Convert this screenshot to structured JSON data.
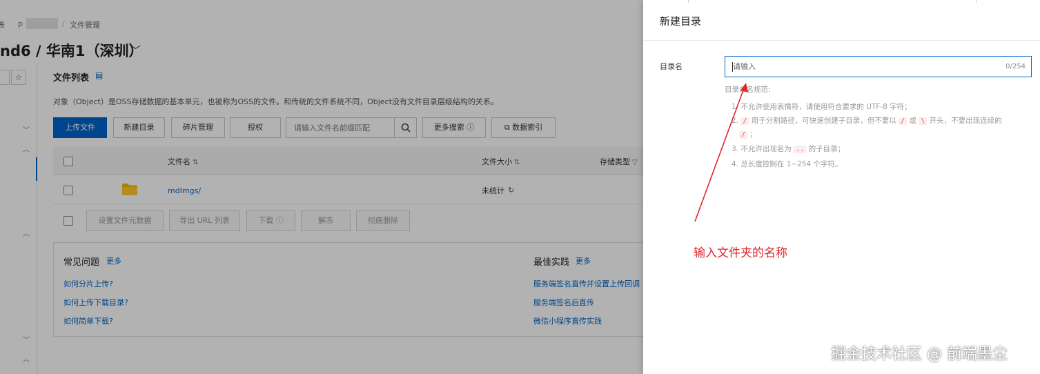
{
  "breadcrumb": {
    "part1": "表",
    "part2": "p",
    "separator": "/",
    "part3": "文件管理"
  },
  "bucket": {
    "title": "nd6 / 华南1（深圳）"
  },
  "file_list": {
    "title": "文件列表",
    "description": "对象（Object）是OSS存储数据的基本单元，也被称为OSS的文件。和传统的文件系统不同，Object没有文件目录层级结构的关系。",
    "toolbar": {
      "upload": "上传文件",
      "new_dir": "新建目录",
      "fragments": "碎片管理",
      "authorize": "授权",
      "search_placeholder": "请输入文件名前缀匹配",
      "more_search": "更多搜索 ⓘ",
      "data_index": "数据索引"
    },
    "columns": {
      "name": "文件名",
      "size": "文件大小",
      "storage": "存储类型"
    },
    "rows": [
      {
        "name": "mdImgs/",
        "size": "未统计"
      }
    ],
    "batch": {
      "set_meta": "设置文件元数据",
      "export_url": "导出 URL 列表",
      "download": "下载 ⓘ",
      "unfreeze": "解冻",
      "delete": "彻底删除"
    }
  },
  "faq": {
    "title": "常见问题",
    "more": "更多",
    "links": [
      "如何分片上传?",
      "如何上传下载目录?",
      "如何简单下载?"
    ],
    "best_title": "最佳实践",
    "best_more": "更多",
    "best_links": [
      "服务端签名直传并设置上传回调",
      "服务端签名后直传",
      "微信小程序直传实践"
    ]
  },
  "drawer": {
    "title": "新建目录",
    "field_label": "目录名",
    "placeholder": "请输入",
    "counter": "0/254",
    "rules_title": "目录命名规范:",
    "rule1": "1. 不允许使用表情符，请使用符合要求的 UTF-8 字符；",
    "rule2_a": "2.",
    "rule2_b": "用于分割路径，可快速创建子目录，但不要以",
    "rule2_c": "或",
    "rule2_d": "开头，不要出现连续的",
    "rule2_e": "；",
    "rule2_slash": "/",
    "rule2_backslash": "\\",
    "rule3_a": "3. 不允许出现名为",
    "rule3_code": "..",
    "rule3_b": "的子目录；",
    "rule4": "4. 总长度控制在 1~254 个字符。"
  },
  "annotation": "输入文件夹的名称",
  "watermark": "掘金技术社区 @ 前端墨尘",
  "colors": {
    "accent": "#0064c8",
    "annotation": "#e0252b"
  },
  "icons": [
    "star-icon",
    "doc-icon",
    "search-icon",
    "sort-icon",
    "folder-icon",
    "refresh-icon",
    "external-link-icon",
    "chevron-down-icon",
    "chevron-up-icon"
  ]
}
